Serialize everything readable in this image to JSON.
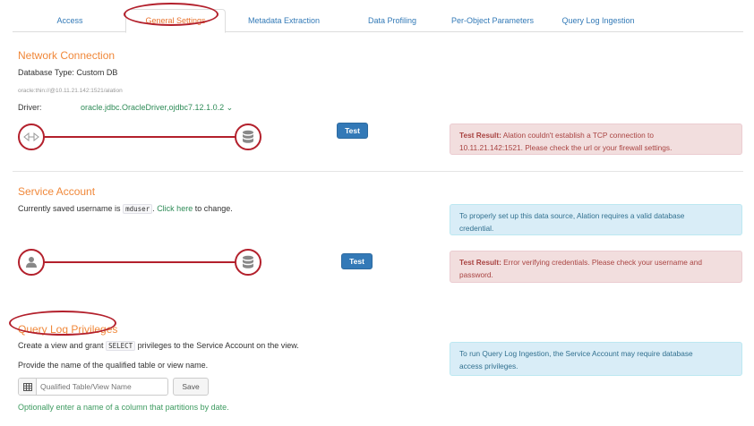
{
  "tabs": [
    "Access",
    "General Settings",
    "Metadata Extraction",
    "Data Profiling",
    "Per-Object Parameters",
    "Query Log Ingestion"
  ],
  "network": {
    "title": "Network Connection",
    "db_type": "Database Type: Custom DB",
    "uri": "oracle:thin://@10.11.21.142:1521/alation",
    "driver_label": "Driver:",
    "driver_value": "oracle.jdbc.OracleDriver,ojdbc7.12.1.0.2 ⌄",
    "test_label": "Test",
    "result_strong": "Test Result:",
    "result_line1": " Alation couldn't establish a TCP connection to",
    "result_line2": "10.11.21.142:1521. Please check the url or your firewall settings."
  },
  "service": {
    "title": "Service Account",
    "saved_prefix": "Currently saved username is ",
    "username": "mduser",
    "saved_suffix": ".",
    "change_link": "Click here",
    "change_suffix": " to change.",
    "info_line1": "To properly set up this data source, Alation requires a valid database",
    "info_line2": "credential.",
    "test_label": "Test",
    "result_strong": "Test Result:",
    "result_line1": " Error verifying credentials. Please check your username and",
    "result_line2": "password."
  },
  "qlp": {
    "title": "Query Log Privileges",
    "grant_prefix": "Create a view and grant ",
    "grant_code": "SELECT",
    "grant_suffix": " privileges to the Service Account on the view.",
    "provide_text": "Provide the name of the qualified table or view name.",
    "input_placeholder": "Qualified Table/View Name",
    "save_label": "Save",
    "optional_text": "Optionally enter a name of a column that partitions by date.",
    "info_line1": "To run Query Log Ingestion, the Service Account may require database",
    "info_line2": "access privileges."
  },
  "colors": {
    "accent_orange": "#f0883a",
    "annotation_red": "#b3202c",
    "button_blue": "#3379b7"
  }
}
